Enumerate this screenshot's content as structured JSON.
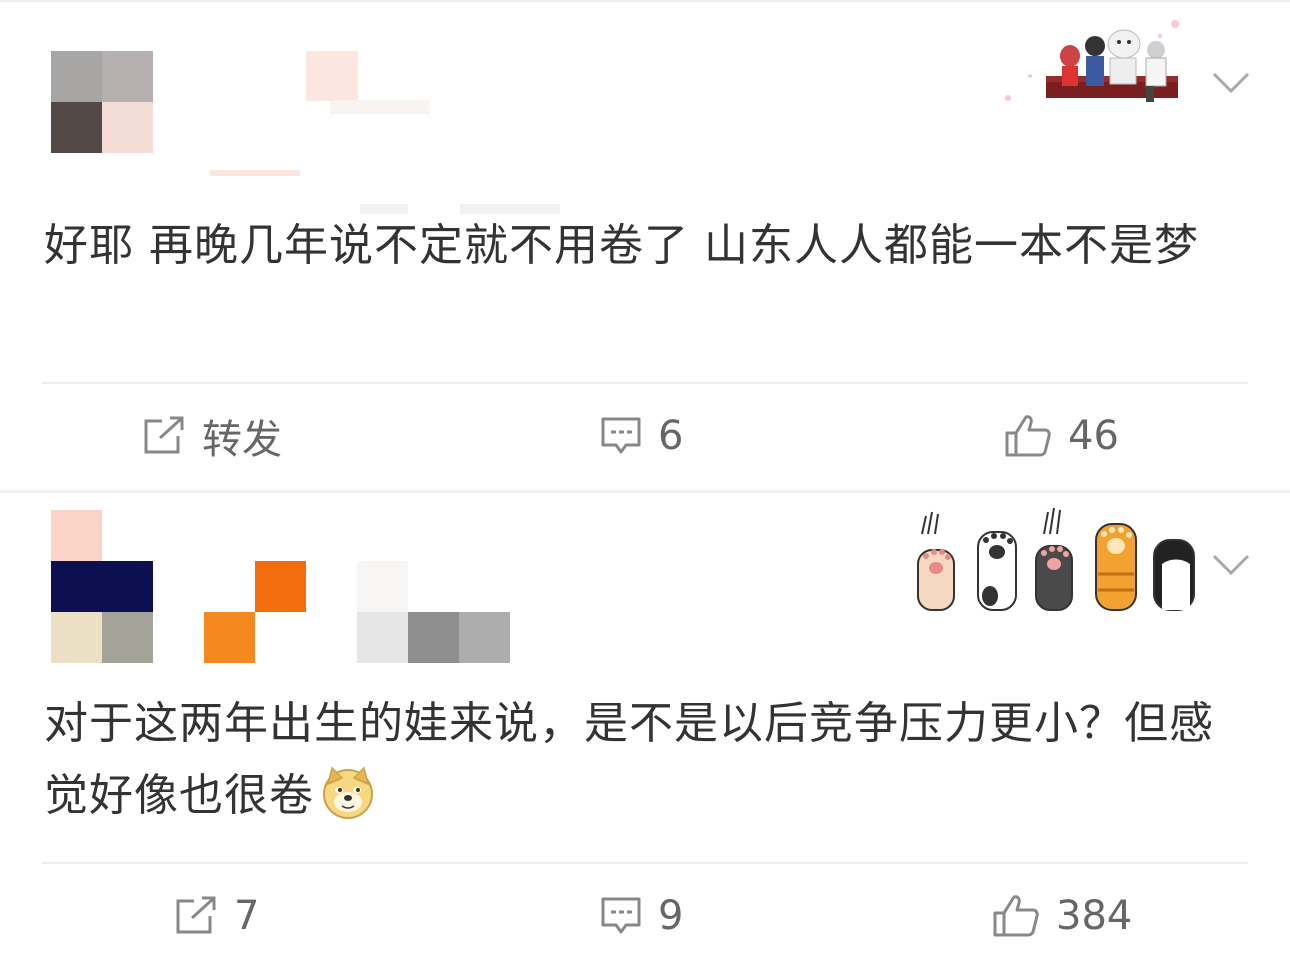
{
  "posts": [
    {
      "text": "好耶 再晚几年说不定就不用卷了 山东人人都能一本不是梦",
      "actions": {
        "repost_icon": "repost-icon",
        "repost_label": "转发",
        "comment_icon": "comment-icon",
        "comment_count": "6",
        "like_icon": "thumbs-up-icon",
        "like_count": "46"
      }
    },
    {
      "text": "对于这两年出生的娃来说，是不是以后竞争压力更小？但感觉好像也很卷",
      "emoji": "doge-emoji",
      "actions": {
        "repost_icon": "repost-icon",
        "repost_label": "7",
        "comment_icon": "comment-icon",
        "comment_count": "9",
        "like_icon": "thumbs-up-icon",
        "like_count": "384"
      }
    }
  ],
  "colors": {
    "text": "#333333",
    "action_text": "#666666",
    "divider": "#eeeeee",
    "icon": "#888888"
  }
}
